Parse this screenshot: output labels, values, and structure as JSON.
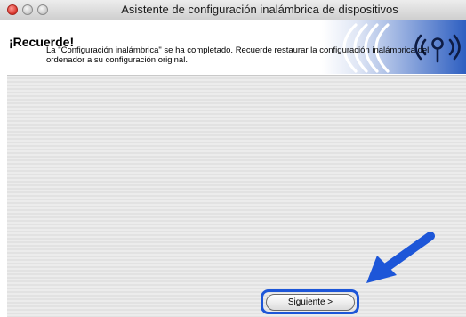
{
  "window": {
    "title": "Asistente de configuración inalámbrica de dispositivos"
  },
  "header": {
    "title": "¡Recuerde!",
    "logo_icon": "wireless-signal-icon"
  },
  "content": {
    "message": "La \"Configuración inalámbrica\" se ha completado. Recuerde restaurar la configuración inalámbrica del ordenador a su configuración original."
  },
  "footer": {
    "next_button_label": "Siguiente >",
    "highlight_color": "#1d56d8"
  }
}
